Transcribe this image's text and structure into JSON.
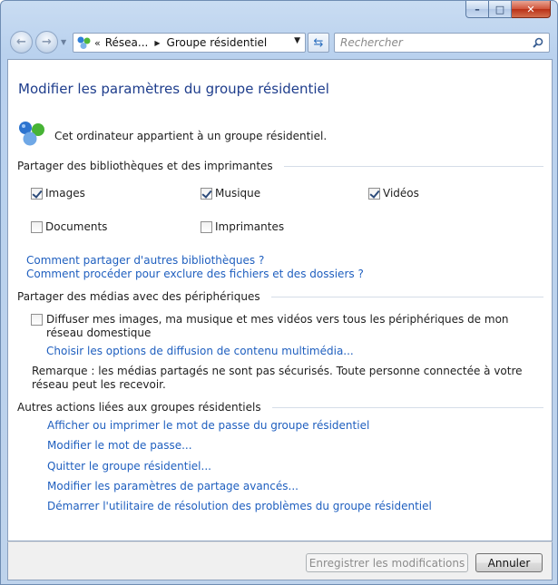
{
  "toolbar": {
    "address_overflow": "«",
    "address_crumb1": "Résea...",
    "address_crumb2": "Groupe résidentiel",
    "search_placeholder": "Rechercher"
  },
  "page": {
    "title": "Modifier les paramètres du groupe résidentiel",
    "membership": "Cet ordinateur appartient à un groupe résidentiel."
  },
  "libraries": {
    "heading": "Partager des bibliothèques et des imprimantes",
    "items": [
      {
        "label": "Images",
        "checked": true
      },
      {
        "label": "Musique",
        "checked": true
      },
      {
        "label": "Vidéos",
        "checked": true
      },
      {
        "label": "Documents",
        "checked": false
      },
      {
        "label": "Imprimantes",
        "checked": false
      }
    ],
    "link_share_other": "Comment partager d'autres bibliothèques ?",
    "link_exclude": "Comment procéder pour exclure des fichiers et des dossiers ?"
  },
  "media": {
    "heading": "Partager des médias avec des périphériques",
    "stream_label": "Diffuser mes images, ma musique et mes vidéos vers tous les périphériques de mon réseau domestique",
    "stream_checked": false,
    "link_options": "Choisir les options de diffusion de contenu multimédia...",
    "remark": "Remarque : les médias partagés ne sont pas sécurisés. Toute personne connectée à votre réseau peut les recevoir."
  },
  "other_actions": {
    "heading": "Autres actions liées aux groupes résidentiels",
    "links": [
      "Afficher ou imprimer le mot de passe du groupe résidentiel",
      "Modifier le mot de passe...",
      "Quitter le groupe résidentiel...",
      "Modifier les paramètres de partage avancés...",
      "Démarrer l'utilitaire de résolution des problèmes du groupe résidentiel"
    ]
  },
  "footer": {
    "save_label": "Enregistrer les modifications",
    "cancel_label": "Annuler"
  },
  "colors": {
    "link": "#1f5fbf",
    "title": "#1e3d8c",
    "frame": "#bed3ec"
  }
}
